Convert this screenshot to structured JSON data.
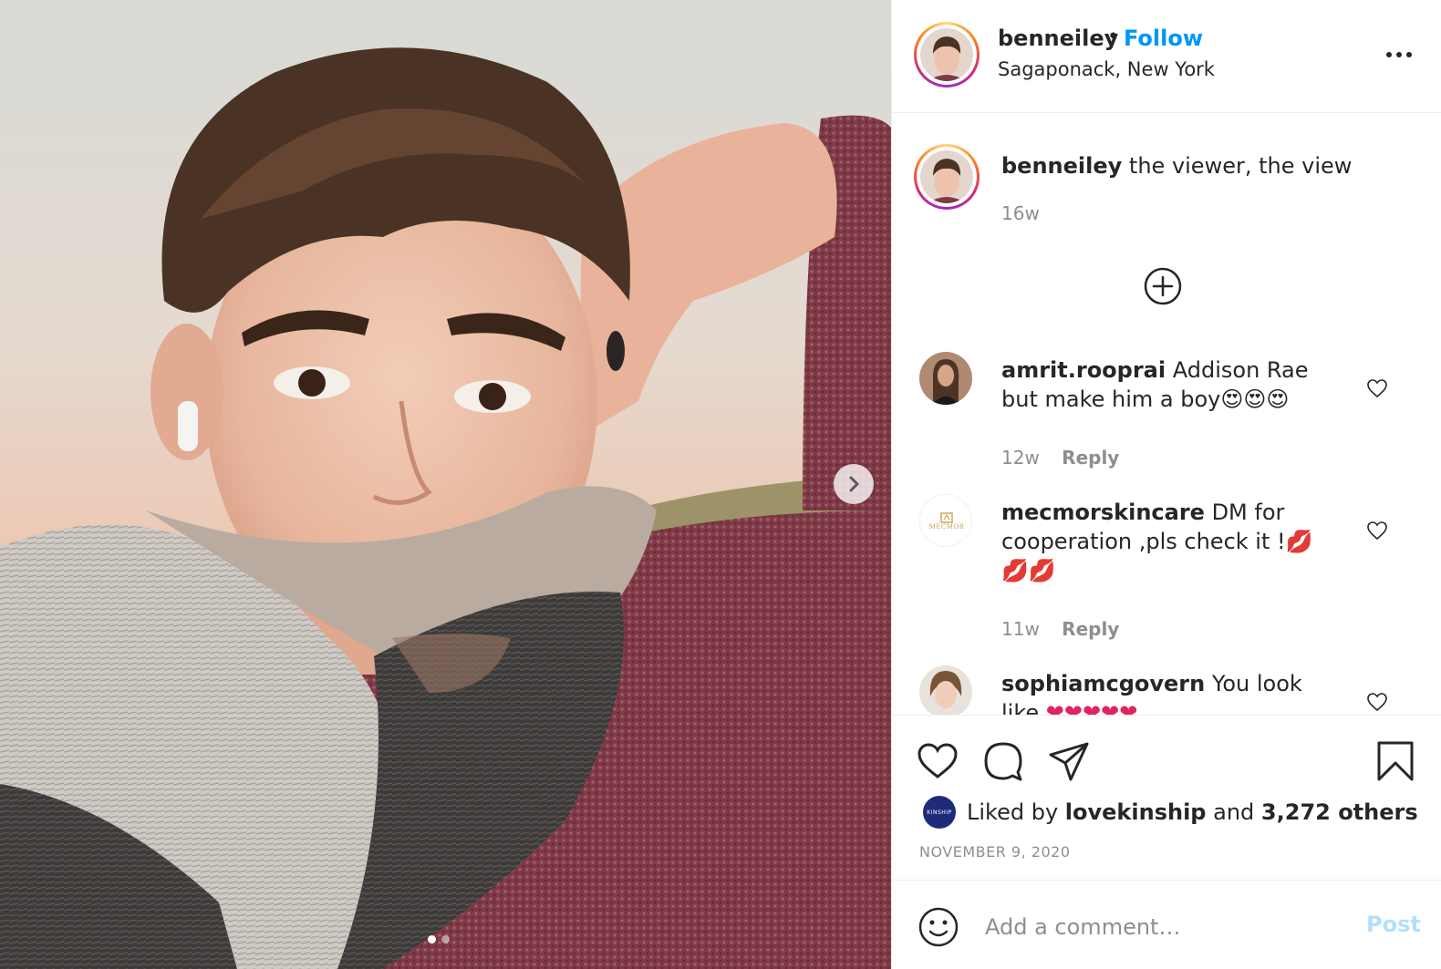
{
  "post": {
    "author": {
      "username": "benneiley",
      "follow_label": "Follow",
      "bullet": "•",
      "location": "Sagaponack, New York"
    },
    "caption": {
      "username": "benneiley",
      "text": "the viewer, the view",
      "time": "16w"
    },
    "comments": [
      {
        "username": "amrit.rooprai",
        "text": "Addison Rae but make him a boy😍😍😍",
        "time": "12w",
        "reply_label": "Reply"
      },
      {
        "username": "mecmorskincare",
        "avatar_text": "MECMOR",
        "text": "DM for cooperation ,pls check it !💋💋💋",
        "time": "11w",
        "reply_label": "Reply"
      },
      {
        "username": "sophiamcgovern",
        "text": "You look like",
        "extra": "❤❤❤❤❤"
      }
    ],
    "likes": {
      "prefix": "Liked by",
      "user": "lovekinship",
      "user_avatar_text": "KINSHIP",
      "conj": "and",
      "count_text": "3,272 others"
    },
    "date": "NOVEMBER 9, 2020",
    "add_comment": {
      "placeholder": "Add a comment…",
      "post_label": "Post"
    },
    "carousel": {
      "total": 2,
      "current": 1
    }
  },
  "icons": {
    "more": "more-horizontal-icon",
    "like": "heart-icon",
    "comment": "comment-bubble-icon",
    "share": "paper-plane-icon",
    "save": "bookmark-icon",
    "load_more": "plus-circle-icon",
    "emoji": "smiley-icon",
    "next": "chevron-right-icon"
  },
  "colors": {
    "link_blue": "#0095f6",
    "post_disabled": "#b2dffc",
    "meta_gray": "#8e8e8e",
    "text": "#262626",
    "border": "#efefef"
  }
}
